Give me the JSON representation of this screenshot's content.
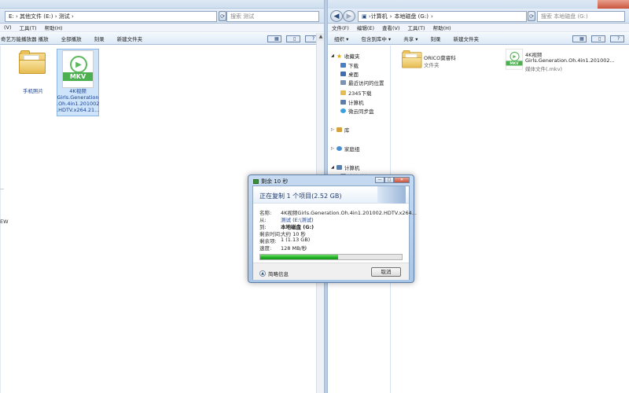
{
  "left": {
    "top_items": [
      "",
      "",
      "",
      "",
      "",
      "",
      "",
      "",
      "",
      ""
    ],
    "address": "E: › 其他文件 (E:) › 测试 ›",
    "search_placeholder": "搜索 测试",
    "menu": [
      "(V)",
      "工具(T)",
      "帮助(H)"
    ],
    "cmd": [
      "奇艺万能播放器 播放",
      "全部播放",
      "刻录",
      "新建文件夹"
    ],
    "side_text": "EW",
    "folder_label": "手机照片",
    "mkv_label": "MKV",
    "mkv_caption": [
      "4K视频",
      "Girls.Generation",
      ".Oh.4in1.201002",
      ".HDTV.x264.21..."
    ]
  },
  "right": {
    "breadcrumb": [
      "计算机",
      "本地磁盘 (G:)"
    ],
    "search_placeholder": "搜索 本地磁盘 (G:)",
    "menu": [
      "文件(F)",
      "编辑(E)",
      "查看(V)",
      "工具(T)",
      "帮助(H)"
    ],
    "cmd": [
      "组织 ▾",
      "包含到库中 ▾",
      "共享 ▾",
      "刻录",
      "新建文件夹"
    ],
    "nav": {
      "favorites": "收藏夹",
      "downloads": "下载",
      "desktop": "桌面",
      "recent": "最近访问的位置",
      "dl2345": "2345下载",
      "computer_fav": "计算机",
      "wps": "微云同步盘",
      "library": "库",
      "homegroup": "家庭组",
      "computer": "计算机",
      "partial": "本地磁盘 (C:)"
    },
    "files": [
      {
        "name": "ORICO莫睿科",
        "type": "文件夹"
      },
      {
        "name": "4K视频",
        "name2": "Girls.Generation.Oh.4in1.201002...",
        "type": "媒体文件(.mkv)"
      }
    ],
    "mkv_label": "MKV"
  },
  "dialog": {
    "title": "剩余 10 秒",
    "heading": "正在复制 1 个项目(2.52 GB)",
    "rows": [
      {
        "k": "名称:",
        "v": "4K视频Girls.Generation.Oh.4in1.201002.HDTV.x264..."
      },
      {
        "k": "从:",
        "v": "测试 (E:\\测试)"
      },
      {
        "k": "到:",
        "v": "本地磁盘 (G:)"
      },
      {
        "k": "剩余时间:",
        "v": "大约 10 秒"
      },
      {
        "k": "剩余项:",
        "v": "1 (1.13 GB)"
      },
      {
        "k": "速度:",
        "v": "128 MB/秒"
      }
    ],
    "progress_fraction": 0.55,
    "more_info": "简略信息",
    "cancel": "取消"
  }
}
